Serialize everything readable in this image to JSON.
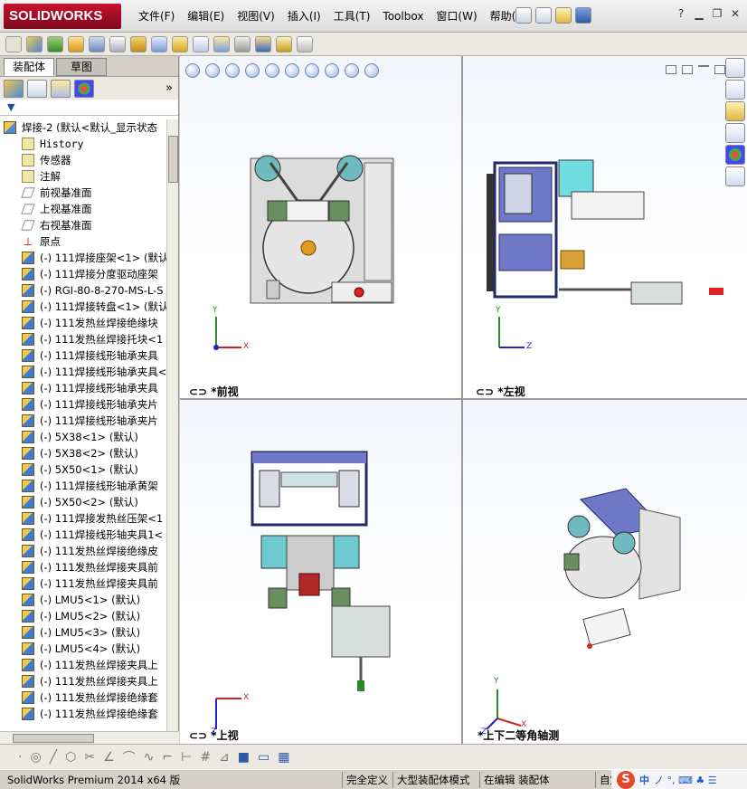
{
  "app": {
    "brand": "SOLIDWORKS",
    "menu": [
      "文件(F)",
      "编辑(E)",
      "视图(V)",
      "插入(I)",
      "工具(T)",
      "Toolbox",
      "窗口(W)",
      "帮助(H)"
    ],
    "help_label": "?"
  },
  "panel": {
    "tabs": [
      "装配体",
      "草图"
    ],
    "filter_label": "▼",
    "root": "焊接-2  (默认<默认_显示状态"
  },
  "tree": [
    {
      "label": "History",
      "kind": "folder"
    },
    {
      "label": "传感器",
      "kind": "folder"
    },
    {
      "label": "注解",
      "kind": "folder"
    },
    {
      "label": "前视基准面",
      "kind": "plane"
    },
    {
      "label": "上视基准面",
      "kind": "plane"
    },
    {
      "label": "右视基准面",
      "kind": "plane"
    },
    {
      "label": "原点",
      "kind": "origin"
    },
    {
      "label": "(-) 111焊接座架<1> (默认",
      "kind": "part"
    },
    {
      "label": "(-) 111焊接分度驱动座架",
      "kind": "part"
    },
    {
      "label": "(-) RGI-80-8-270-MS-L-S",
      "kind": "part"
    },
    {
      "label": "(-) 111焊接转盘<1> (默认",
      "kind": "part"
    },
    {
      "label": "(-) 111发热丝焊接绝缘块",
      "kind": "part"
    },
    {
      "label": "(-) 111发热丝焊接托块<1",
      "kind": "part"
    },
    {
      "label": "(-) 111焊接线形轴承夹具",
      "kind": "part"
    },
    {
      "label": "(-) 111焊接线形轴承夹具<1",
      "kind": "part"
    },
    {
      "label": "(-) 111焊接线形轴承夹具",
      "kind": "part"
    },
    {
      "label": "(-) 111焊接线形轴承夹片",
      "kind": "part"
    },
    {
      "label": "(-) 111焊接线形轴承夹片",
      "kind": "part"
    },
    {
      "label": "(-) 5X38<1> (默认)",
      "kind": "part"
    },
    {
      "label": "(-) 5X38<2> (默认)",
      "kind": "part"
    },
    {
      "label": "(-) 5X50<1> (默认)",
      "kind": "part"
    },
    {
      "label": "(-) 111焊接线形轴承黄架",
      "kind": "part"
    },
    {
      "label": "(-) 5X50<2> (默认)",
      "kind": "part"
    },
    {
      "label": "(-) 111焊接发热丝压架<1",
      "kind": "part"
    },
    {
      "label": "(-) 111焊接线形轴夹具1<",
      "kind": "part"
    },
    {
      "label": "(-) 111发热丝焊接绝缘皮",
      "kind": "part"
    },
    {
      "label": "(-) 111发热丝焊接夹具前",
      "kind": "part"
    },
    {
      "label": "(-) 111发热丝焊接夹具前",
      "kind": "part"
    },
    {
      "label": "(-) LMU5<1> (默认)",
      "kind": "part"
    },
    {
      "label": "(-) LMU5<2> (默认)",
      "kind": "part"
    },
    {
      "label": "(-) LMU5<3> (默认)",
      "kind": "part"
    },
    {
      "label": "(-) LMU5<4> (默认)",
      "kind": "part"
    },
    {
      "label": "(-) 111发热丝焊接夹具上",
      "kind": "part"
    },
    {
      "label": "(-) 111发热丝焊接夹具上",
      "kind": "part"
    },
    {
      "label": "(-) 111发热丝焊接绝缘套",
      "kind": "part"
    },
    {
      "label": "(-) 111发热丝焊接绝缘套",
      "kind": "part"
    }
  ],
  "views": {
    "front": "*前视",
    "left": "*左视",
    "top": "*上视",
    "iso": "*上下二等角轴测"
  },
  "axes": {
    "x": "X",
    "y": "Y",
    "z": "Z"
  },
  "status": {
    "product": "SolidWorks Premium 2014 x64 版",
    "s1": "完全定义",
    "s2": "大型装配体模式",
    "s3": "在编辑 装配体",
    "s4": "自定"
  },
  "ime": {
    "s": "S",
    "zh": "中",
    "items": "ノ °, ⌨ ♣ ☰"
  }
}
